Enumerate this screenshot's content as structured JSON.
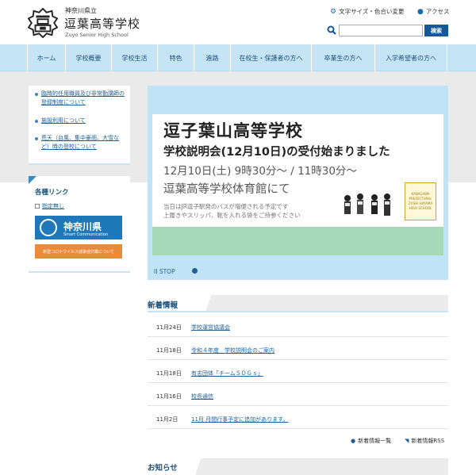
{
  "header": {
    "prefecture": "神奈川県立",
    "school_name": "逗葉高等学校",
    "school_name_en": "Zuyo Senior High School",
    "util_links": [
      {
        "label": "文字サイズ・色合い変更",
        "icon": "sliders-icon"
      },
      {
        "label": "アクセス",
        "icon": "map-pin-icon"
      }
    ],
    "search_placeholder": "",
    "search_button": "検索"
  },
  "nav": {
    "items": [
      {
        "label": "ホーム"
      },
      {
        "label": "学校概要"
      },
      {
        "label": "学校生活"
      },
      {
        "label": "特色"
      },
      {
        "label": "進路"
      },
      {
        "label": "在校生・保護者の方へ"
      },
      {
        "label": "卒業生の方へ"
      },
      {
        "label": "入学希望者の方へ"
      }
    ]
  },
  "sidebar": {
    "notices": [
      {
        "label": "臨時的任用職員及び非常勤講師の登録制度について"
      },
      {
        "label": "施設利用について"
      },
      {
        "label": "荒天（台風、集中豪雨、大雪など）時の登校について"
      }
    ],
    "links_title": "各種リンク",
    "link_item": "指定無し",
    "banner1_text": "神奈川県",
    "banner1_sub": "Smart Communication",
    "banner2_text": "新型コロナウイルス感染症対策について"
  },
  "slider": {
    "line1": "逗子葉山高等学校",
    "line2": "学校説明会(12月10日)の受付始まりました",
    "line3": "12月10日(土) 9時30分～ / 11時30分～",
    "line4": "逗葉高等学校体育館にて",
    "line5a": "当日はJR逗子駅発のバスが増便される予定です",
    "line5b": "上履きやスリッパ、靴を入れる袋をご持参ください",
    "badge": "KANAGAWA PREFECTURAL ZUSHI HAYAMA HIGH SCHOOL",
    "stop_label": "STOP",
    "colors": {
      "frame": "#c0e3f5",
      "band": "#a6d8b9"
    }
  },
  "news": {
    "title": "新着情報",
    "items": [
      {
        "date": "11月24日",
        "title": "学校運営協議会"
      },
      {
        "date": "11月18日",
        "title": "令和４年度　学校説明会のご案内"
      },
      {
        "date": "11月18日",
        "title": "有志団体「チームＳＤＧｓ」"
      },
      {
        "date": "11月16日",
        "title": "校長通信"
      },
      {
        "date": "11月2日",
        "title": "11月 月間行事予定に追加があります。"
      }
    ],
    "list_link": "新着情報一覧",
    "rss_link": "新着情報RSS"
  },
  "notice": {
    "title": "お知らせ"
  }
}
